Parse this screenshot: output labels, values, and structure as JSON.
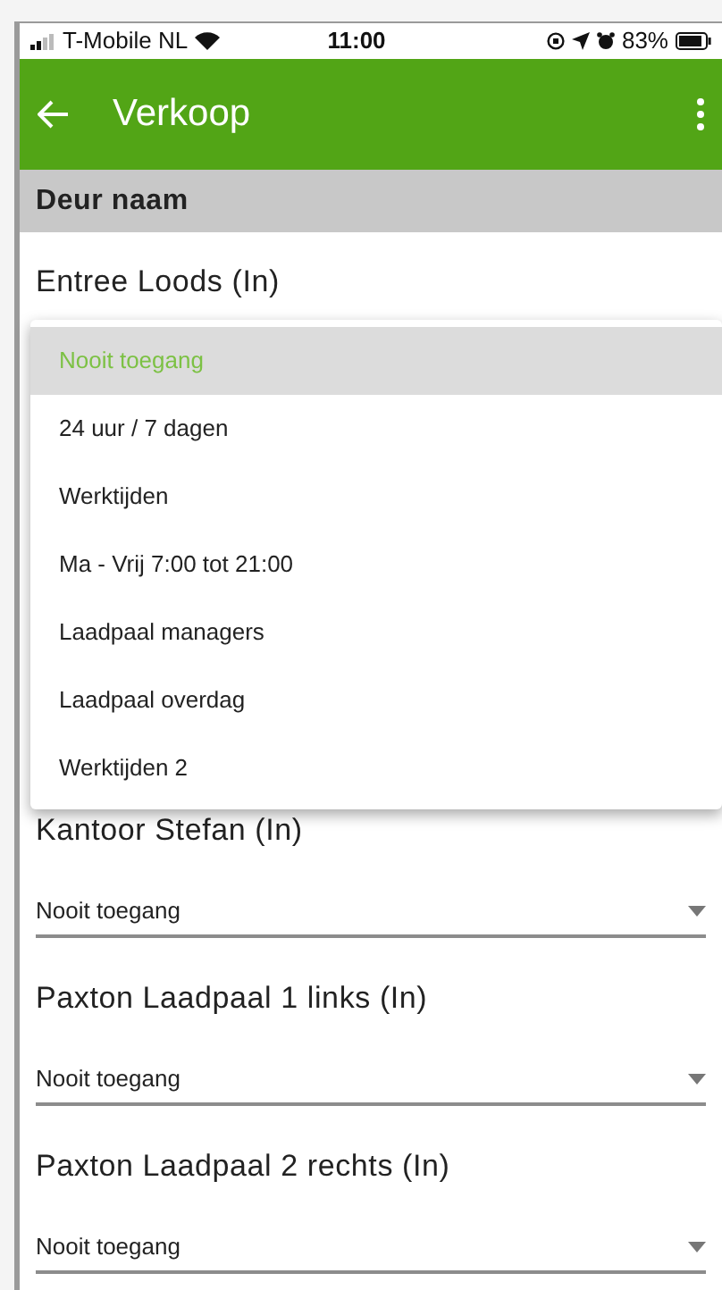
{
  "status_bar": {
    "carrier": "T-Mobile NL",
    "time": "11:00",
    "battery": "83%"
  },
  "app_bar": {
    "title": "Verkoop"
  },
  "column_header": "Deur naam",
  "doors": [
    {
      "name": "Entree Loods (In)"
    },
    {
      "name": "Kantoor Stefan (In)",
      "value": "Nooit toegang"
    },
    {
      "name": "Paxton Laadpaal 1 links (In)",
      "value": "Nooit toegang"
    },
    {
      "name": "Paxton Laadpaal 2 rechts (In)",
      "value": "Nooit toegang"
    }
  ],
  "open_menu": {
    "items": [
      {
        "label": "Nooit toegang",
        "selected": true
      },
      {
        "label": "24 uur / 7 dagen",
        "selected": false
      },
      {
        "label": "Werktijden",
        "selected": false
      },
      {
        "label": "Ma - Vrij 7:00 tot 21:00",
        "selected": false
      },
      {
        "label": "Laadpaal managers",
        "selected": false
      },
      {
        "label": "Laadpaal overdag",
        "selected": false
      },
      {
        "label": "Werktijden 2",
        "selected": false
      }
    ]
  }
}
